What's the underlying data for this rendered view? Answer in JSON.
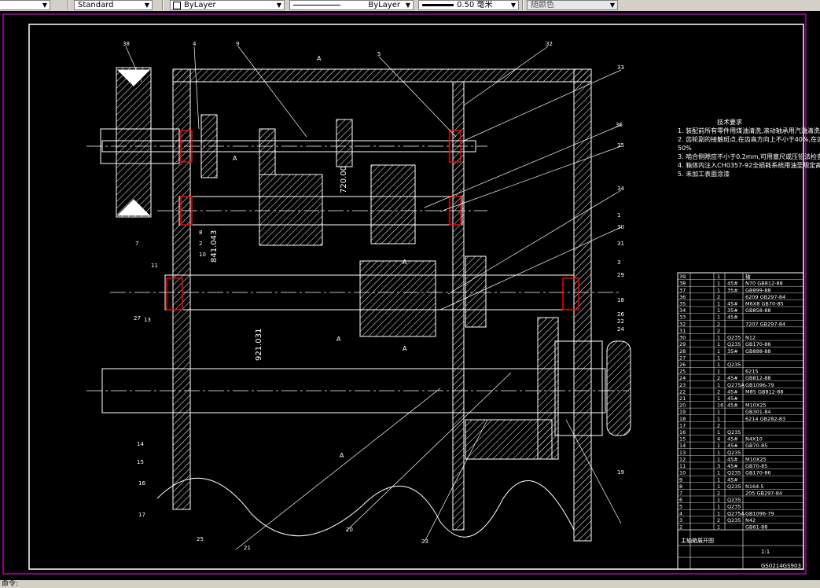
{
  "toolbar": {
    "dimstyle_value": "Standard",
    "layer_value": "ByLayer",
    "linetype_value": "ByLayer",
    "lineweight_value": "0.50 毫米",
    "color_value": "随颜色"
  },
  "drawing": {
    "tech_title": "技术要求",
    "tech_notes": [
      "1. 装配前所有零件用煤油清洗,滚动轴承用汽油清洗",
      "2. 齿轮副的接触斑点,在齿高方向上不小于40%,在齿长方向上不小于",
      "50%",
      "3. 啮合侧隙应不小于0.2mm,可用塞尺或压铅法检查",
      "4. 箱体内注入CH0357-92全损耗系统用油至规定高度",
      "5. 未加工表面涂漆"
    ],
    "dims": [
      "841.043",
      "921.031",
      "720.00"
    ],
    "balloons": [
      "38",
      "4",
      "9",
      "5",
      "32",
      "33",
      "36",
      "35",
      "34",
      "1",
      "30",
      "31",
      "3",
      "29",
      "18",
      "26",
      "22",
      "24",
      "19",
      "8",
      "2",
      "10",
      "11",
      "27",
      "13",
      "14",
      "15",
      "16",
      "17",
      "25",
      "21",
      "20",
      "23",
      "7"
    ],
    "section_letters": [
      "A",
      "A",
      "A",
      "A",
      "A",
      "A"
    ],
    "bom_rows": [
      {
        "no": "39",
        "name": "",
        "qty": "1",
        "mat": "",
        "note": "轴"
      },
      {
        "no": "38",
        "name": "",
        "qty": "1",
        "mat": "45#",
        "note": "N70 GB812-88"
      },
      {
        "no": "37",
        "name": "",
        "qty": "1",
        "mat": "35#",
        "note": "GB899-88"
      },
      {
        "no": "36",
        "name": "",
        "qty": "2",
        "mat": "",
        "note": "6209 GB297-84"
      },
      {
        "no": "35",
        "name": "",
        "qty": "1",
        "mat": "45#",
        "note": "M6X8 GB70-85"
      },
      {
        "no": "34",
        "name": "",
        "qty": "1",
        "mat": "35#",
        "note": "GB858-88"
      },
      {
        "no": "33",
        "name": "",
        "qty": "1",
        "mat": "45#",
        "note": ""
      },
      {
        "no": "32",
        "name": "",
        "qty": "2",
        "mat": "",
        "note": "7207 GB297-84"
      },
      {
        "no": "31",
        "name": "",
        "qty": "2",
        "mat": "",
        "note": ""
      },
      {
        "no": "30",
        "name": "",
        "qty": "1",
        "mat": "Q235",
        "note": "N12"
      },
      {
        "no": "29",
        "name": "",
        "qty": "1",
        "mat": "Q235",
        "note": "GB170-86"
      },
      {
        "no": "28",
        "name": "",
        "qty": "1",
        "mat": "35#",
        "note": "GB888-88"
      },
      {
        "no": "27",
        "name": "",
        "qty": "1",
        "mat": "",
        "note": ""
      },
      {
        "no": "26",
        "name": "",
        "qty": "1",
        "mat": "Q235",
        "note": ""
      },
      {
        "no": "25",
        "name": "",
        "qty": "1",
        "mat": "",
        "note": "6215"
      },
      {
        "no": "24",
        "name": "",
        "qty": "2",
        "mat": "45#",
        "note": "GB812-88"
      },
      {
        "no": "23",
        "name": "",
        "qty": "1",
        "mat": "Q275A",
        "note": "GB1096-79"
      },
      {
        "no": "22",
        "name": "",
        "qty": "2",
        "mat": "45#",
        "note": "M85 GB812-88"
      },
      {
        "no": "21",
        "name": "",
        "qty": "1",
        "mat": "45#",
        "note": ""
      },
      {
        "no": "20",
        "name": "",
        "qty": "16",
        "mat": "45#",
        "note": "M10X25"
      },
      {
        "no": "19",
        "name": "",
        "qty": "1",
        "mat": "",
        "note": "GB301-84"
      },
      {
        "no": "18",
        "name": "",
        "qty": "1",
        "mat": "",
        "note": "6214 GB282-83"
      },
      {
        "no": "17",
        "name": "",
        "qty": "2",
        "mat": "",
        "note": ""
      },
      {
        "no": "16",
        "name": "",
        "qty": "1",
        "mat": "Q235",
        "note": ""
      },
      {
        "no": "15",
        "name": "",
        "qty": "4",
        "mat": "45#",
        "note": "N4X10"
      },
      {
        "no": "14",
        "name": "",
        "qty": "1",
        "mat": "45#",
        "note": "GB70-85"
      },
      {
        "no": "13",
        "name": "",
        "qty": "1",
        "mat": "Q235",
        "note": ""
      },
      {
        "no": "12",
        "name": "",
        "qty": "1",
        "mat": "45#",
        "note": "M10X25"
      },
      {
        "no": "11",
        "name": "",
        "qty": "3",
        "mat": "45#",
        "note": "GB70-85"
      },
      {
        "no": "10",
        "name": "",
        "qty": "1",
        "mat": "Q235",
        "note": "GB170-86"
      },
      {
        "no": "9",
        "name": "",
        "qty": "1",
        "mat": "45#",
        "note": ""
      },
      {
        "no": "8",
        "name": "",
        "qty": "1",
        "mat": "Q235",
        "note": "N164.5"
      },
      {
        "no": "7",
        "name": "",
        "qty": "2",
        "mat": "",
        "note": "205 GB297-84"
      },
      {
        "no": "6",
        "name": "",
        "qty": "1",
        "mat": "Q235",
        "note": ""
      },
      {
        "no": "5",
        "name": "",
        "qty": "1",
        "mat": "Q235",
        "note": ""
      },
      {
        "no": "4",
        "name": "",
        "qty": "1",
        "mat": "Q275A",
        "note": "GB1096-79"
      },
      {
        "no": "3",
        "name": "",
        "qty": "2",
        "mat": "Q235",
        "note": "N42"
      },
      {
        "no": "2",
        "name": "",
        "qty": "1",
        "mat": "",
        "note": "GB61-88"
      }
    ],
    "title_block": {
      "title": "主轴箱展开图",
      "scale": "1:1",
      "drawing_no": "GS0214GS903"
    }
  },
  "command_line": "命令:"
}
